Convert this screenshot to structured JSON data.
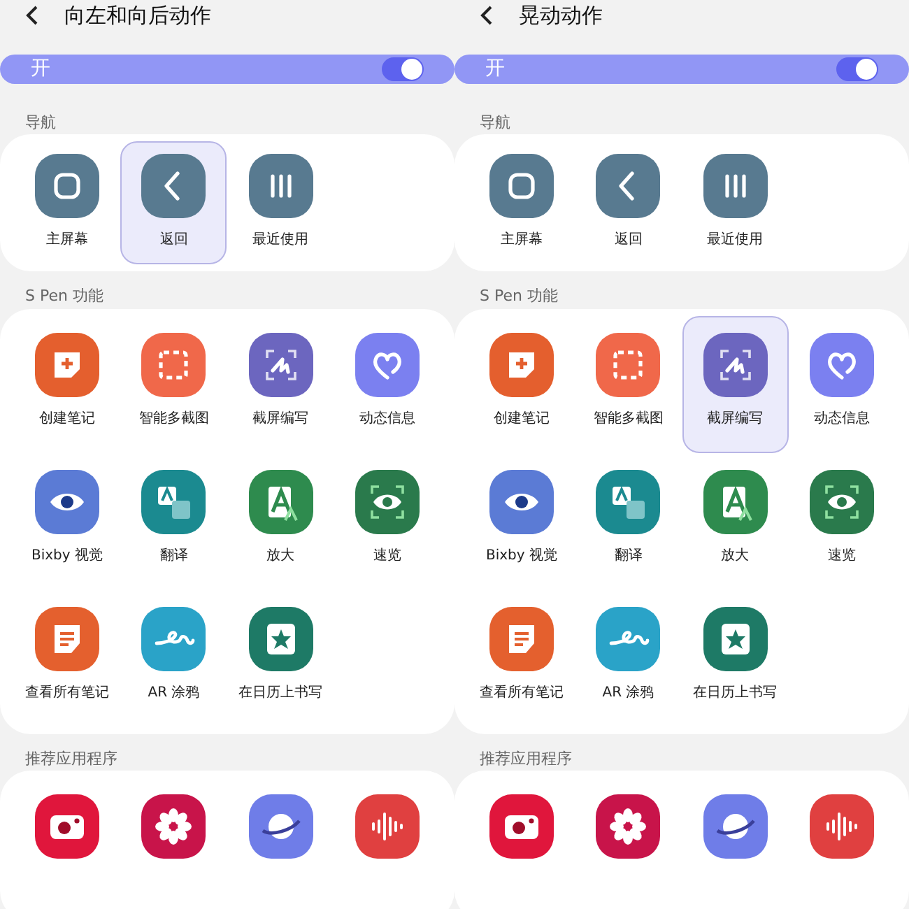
{
  "panels": [
    {
      "title": "向左和向后动作",
      "toggle": {
        "label": "开",
        "on": true
      },
      "sections": [
        {
          "heading": "导航",
          "items": [
            {
              "label": "主屏幕",
              "kind": "home",
              "color": "#587a90",
              "selected": false
            },
            {
              "label": "返回",
              "kind": "back",
              "color": "#587a90",
              "selected": true
            },
            {
              "label": "最近使用",
              "kind": "recents",
              "color": "#587a90",
              "selected": false
            }
          ]
        },
        {
          "heading": "S Pen 功能",
          "items": [
            {
              "label": "创建笔记",
              "kind": "note",
              "color": "#e45f2e",
              "selected": false
            },
            {
              "label": "智能多截图",
              "kind": "select",
              "color": "#f0684a",
              "selected": false
            },
            {
              "label": "截屏编写",
              "kind": "write",
              "color": "#6c66bf",
              "selected": false
            },
            {
              "label": "动态信息",
              "kind": "heart",
              "color": "#7b80f0",
              "selected": false
            },
            {
              "label": "Bixby 视觉",
              "kind": "eye",
              "color": "#5b7bd5",
              "selected": false
            },
            {
              "label": "翻译",
              "kind": "translate",
              "color": "#1b8a90",
              "selected": false
            },
            {
              "label": "放大",
              "kind": "magnify",
              "color": "#2e8b4e",
              "selected": false
            },
            {
              "label": "速览",
              "kind": "glance",
              "color": "#2a7a4c",
              "selected": false
            },
            {
              "label": "查看所有笔记",
              "kind": "notes",
              "color": "#e4602e",
              "selected": false
            },
            {
              "label": "AR 涂鸦",
              "kind": "doodle",
              "color": "#2aa3c8",
              "selected": false
            },
            {
              "label": "在日历上书写",
              "kind": "calendar",
              "color": "#1e7a66",
              "selected": false
            }
          ]
        },
        {
          "heading": "推荐应用程序",
          "items": [
            {
              "kind": "camera",
              "color": "#e0163c",
              "selected": false
            },
            {
              "kind": "flower",
              "color": "#c8144a",
              "selected": false
            },
            {
              "kind": "planet",
              "color": "#6f7de8",
              "selected": false
            },
            {
              "kind": "voice",
              "color": "#e04040",
              "selected": false
            }
          ]
        }
      ]
    },
    {
      "title": "晃动动作",
      "toggle": {
        "label": "开",
        "on": true
      },
      "sections": [
        {
          "heading": "导航",
          "items": [
            {
              "label": "主屏幕",
              "kind": "home",
              "color": "#587a90",
              "selected": false
            },
            {
              "label": "返回",
              "kind": "back",
              "color": "#587a90",
              "selected": false
            },
            {
              "label": "最近使用",
              "kind": "recents",
              "color": "#587a90",
              "selected": false
            }
          ]
        },
        {
          "heading": "S Pen 功能",
          "items": [
            {
              "label": "创建笔记",
              "kind": "note",
              "color": "#e45f2e",
              "selected": false
            },
            {
              "label": "智能多截图",
              "kind": "select",
              "color": "#f0684a",
              "selected": false
            },
            {
              "label": "截屏编写",
              "kind": "write",
              "color": "#6c66bf",
              "selected": true
            },
            {
              "label": "动态信息",
              "kind": "heart",
              "color": "#7b80f0",
              "selected": false
            },
            {
              "label": "Bixby 视觉",
              "kind": "eye",
              "color": "#5b7bd5",
              "selected": false
            },
            {
              "label": "翻译",
              "kind": "translate",
              "color": "#1b8a90",
              "selected": false
            },
            {
              "label": "放大",
              "kind": "magnify",
              "color": "#2e8b4e",
              "selected": false
            },
            {
              "label": "速览",
              "kind": "glance",
              "color": "#2a7a4c",
              "selected": false
            },
            {
              "label": "查看所有笔记",
              "kind": "notes",
              "color": "#e4602e",
              "selected": false
            },
            {
              "label": "AR 涂鸦",
              "kind": "doodle",
              "color": "#2aa3c8",
              "selected": false
            },
            {
              "label": "在日历上书写",
              "kind": "calendar",
              "color": "#1e7a66",
              "selected": false
            }
          ]
        },
        {
          "heading": "推荐应用程序",
          "items": [
            {
              "kind": "camera",
              "color": "#e0163c",
              "selected": false
            },
            {
              "kind": "flower",
              "color": "#c8144a",
              "selected": false
            },
            {
              "kind": "planet",
              "color": "#6f7de8",
              "selected": false
            },
            {
              "kind": "voice",
              "color": "#e04040",
              "selected": false
            }
          ]
        }
      ]
    }
  ]
}
